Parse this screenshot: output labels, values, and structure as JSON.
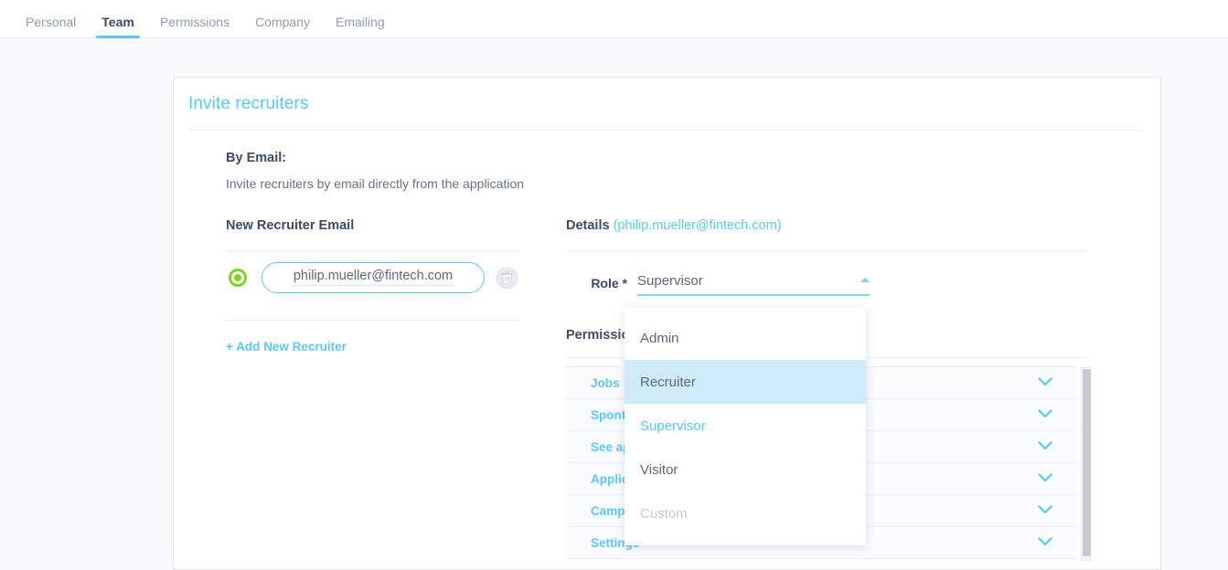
{
  "nav": {
    "tabs": [
      {
        "label": "Personal",
        "active": false
      },
      {
        "label": "Team",
        "active": true
      },
      {
        "label": "Permissions",
        "active": false
      },
      {
        "label": "Company",
        "active": false
      },
      {
        "label": "Emailing",
        "active": false
      }
    ]
  },
  "card": {
    "title": "Invite recruiters",
    "by_email_title": "By Email:",
    "by_email_subtitle": "Invite recruiters by email directly from the application"
  },
  "left": {
    "heading": "New Recruiter Email",
    "recruiter_email": "philip.mueller@fintech.com",
    "delete_icon": "trash-icon",
    "radio_state": "selected",
    "add_link": "+ Add New Recruiter"
  },
  "details": {
    "heading": "Details",
    "heading_email": "(philip.mueller@fintech.com)",
    "role_label": "Role *",
    "role_value": "Supervisor",
    "caret_icon": "caret-up-icon",
    "permissions_heading": "Permissions"
  },
  "permissions": {
    "rows": [
      {
        "label": "Jobs",
        "chevron": "chevron-down-icon"
      },
      {
        "label": "Spont",
        "chevron": "chevron-down-icon"
      },
      {
        "label": "See ap",
        "chevron": "chevron-down-icon"
      },
      {
        "label": "Applic",
        "chevron": "chevron-down-icon"
      },
      {
        "label": "Camp",
        "chevron": "chevron-down-icon"
      },
      {
        "label": "Settings",
        "chevron": "chevron-down-icon"
      }
    ]
  },
  "dropdown": {
    "options": [
      {
        "label": "Admin",
        "state": "normal"
      },
      {
        "label": "Recruiter",
        "state": "hover"
      },
      {
        "label": "Supervisor",
        "state": "selected"
      },
      {
        "label": "Visitor",
        "state": "normal"
      },
      {
        "label": "Custom",
        "state": "disabled"
      }
    ]
  },
  "colors": {
    "accent_blue": "#5bc8f5",
    "text_dark": "#3f4b61",
    "text_muted": "#8e9bb0",
    "green": "#7ed321",
    "page_bg": "#f7f9fb",
    "hover_bg": "#cfeaf8"
  }
}
